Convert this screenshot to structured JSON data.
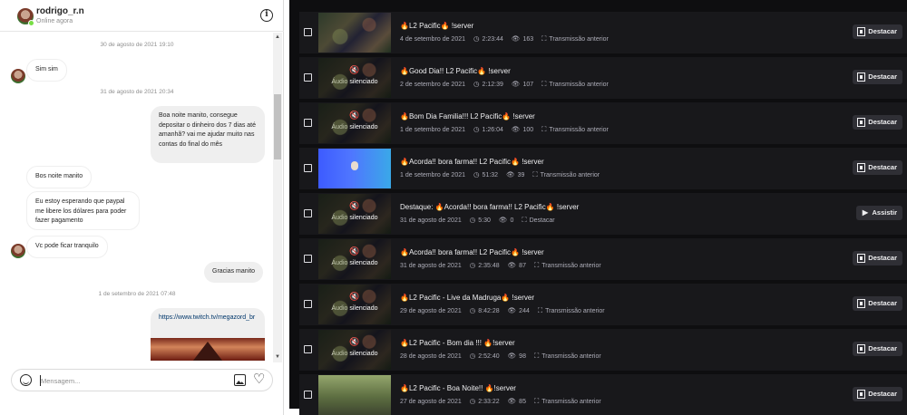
{
  "chat": {
    "username": "rodrigo_r.n",
    "status": "Online agora",
    "dates": [
      "30 de agosto de 2021 19:10",
      "31 de agosto de 2021 20:34",
      "1 de setembro de 2021 07:48"
    ],
    "messages": [
      "Sim sim",
      "Boa noite manito, consegue depositar o dinheiro dos 7 dias até amanhã? vai me ajudar muito nas contas do final do mês",
      "Bos noite manito",
      "Eu estoy esperando que paypal me libere los dólares para poder fazer pagamento",
      "Vc pode ficar tranquilo",
      "Gracias manito"
    ],
    "link": "https://www.twitch.tv/megazord_br",
    "composer_placeholder": "Mensagem...",
    "info_icon": "info-icon",
    "icons": [
      "smile-icon",
      "image-icon",
      "heart-icon"
    ]
  },
  "videos": {
    "muted_label": "Áudio silenciado",
    "highlight_label": "Destacar",
    "watch_label": "Assistir",
    "items": [
      {
        "title": "🔥L2 Pacific🔥 !server",
        "date": "4 de setembro de 2021",
        "duration": "2:23:44",
        "views": "163",
        "type": "Transmissão anterior",
        "muted": false,
        "action": "Destacar"
      },
      {
        "title": "🔥Good Dia!! L2 Pacific🔥 !server",
        "date": "2 de setembro de 2021",
        "duration": "2:12:39",
        "views": "107",
        "type": "Transmissão anterior",
        "muted": true,
        "action": "Destacar"
      },
      {
        "title": "🔥Bom Dia Familia!!! L2 Pacific🔥 !server",
        "date": "1 de setembro de 2021",
        "duration": "1:26:04",
        "views": "100",
        "type": "Transmissão anterior",
        "muted": true,
        "action": "Destacar"
      },
      {
        "title": "🔥Acorda!! bora farma!! L2 Pacific🔥 !server",
        "date": "1 de setembro de 2021",
        "duration": "51:32",
        "views": "39",
        "type": "Transmissão anterior",
        "muted": false,
        "action": "Destacar"
      },
      {
        "title": "Destaque: 🔥Acorda!! bora farma!! L2 Pacific🔥 !server",
        "date": "31 de agosto de 2021",
        "duration": "5:30",
        "views": "0",
        "type": "Destacar",
        "muted": true,
        "action": "Assistir"
      },
      {
        "title": "🔥Acorda!! bora farma!! L2 Pacific🔥 !server",
        "date": "31 de agosto de 2021",
        "duration": "2:35:48",
        "views": "87",
        "type": "Transmissão anterior",
        "muted": true,
        "action": "Destacar"
      },
      {
        "title": "🔥L2 Pacific - Live da Madruga🔥 !server",
        "date": "29 de agosto de 2021",
        "duration": "8:42:28",
        "views": "244",
        "type": "Transmissão anterior",
        "muted": true,
        "action": "Destacar"
      },
      {
        "title": "🔥L2 Pacific - Bom dia !!! 🔥!server",
        "date": "28 de agosto de 2021",
        "duration": "2:52:40",
        "views": "98",
        "type": "Transmissão anterior",
        "muted": true,
        "action": "Destacar"
      },
      {
        "title": "🔥L2 Pacific - Boa Noite!! 🔥!server",
        "date": "27 de agosto de 2021",
        "duration": "2:33:22",
        "views": "85",
        "type": "Transmissão anterior",
        "muted": false,
        "action": "Destacar"
      }
    ]
  }
}
